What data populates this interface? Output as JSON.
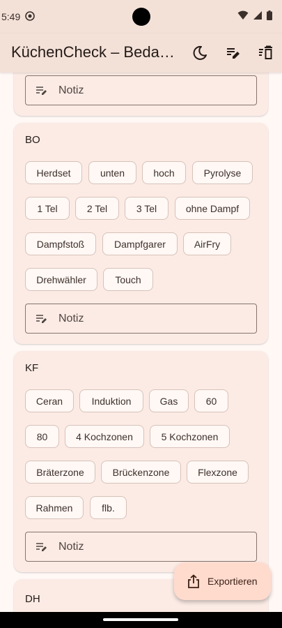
{
  "status_bar": {
    "time": "5:49"
  },
  "app_bar": {
    "title": "KüchenCheck – Bedar…"
  },
  "note_placeholder": "Notiz",
  "sections": [
    {
      "title": "BO",
      "chips": [
        "Herdset",
        "unten",
        "hoch",
        "Pyrolyse",
        "1 Tel",
        "2 Tel",
        "3 Tel",
        "ohne Dampf",
        "Dampfstoß",
        "Dampfgarer",
        "AirFry",
        "Drehwähler",
        "Touch"
      ]
    },
    {
      "title": "KF",
      "chips": [
        "Ceran",
        "Induktion",
        "Gas",
        "60",
        "80",
        "4 Kochzonen",
        "5 Kochzonen",
        "Bräterzone",
        "Brückenzone",
        "Flexzone",
        "Rahmen",
        "flb."
      ]
    },
    {
      "title": "DH"
    }
  ],
  "fab": {
    "label": "Exportieren"
  }
}
